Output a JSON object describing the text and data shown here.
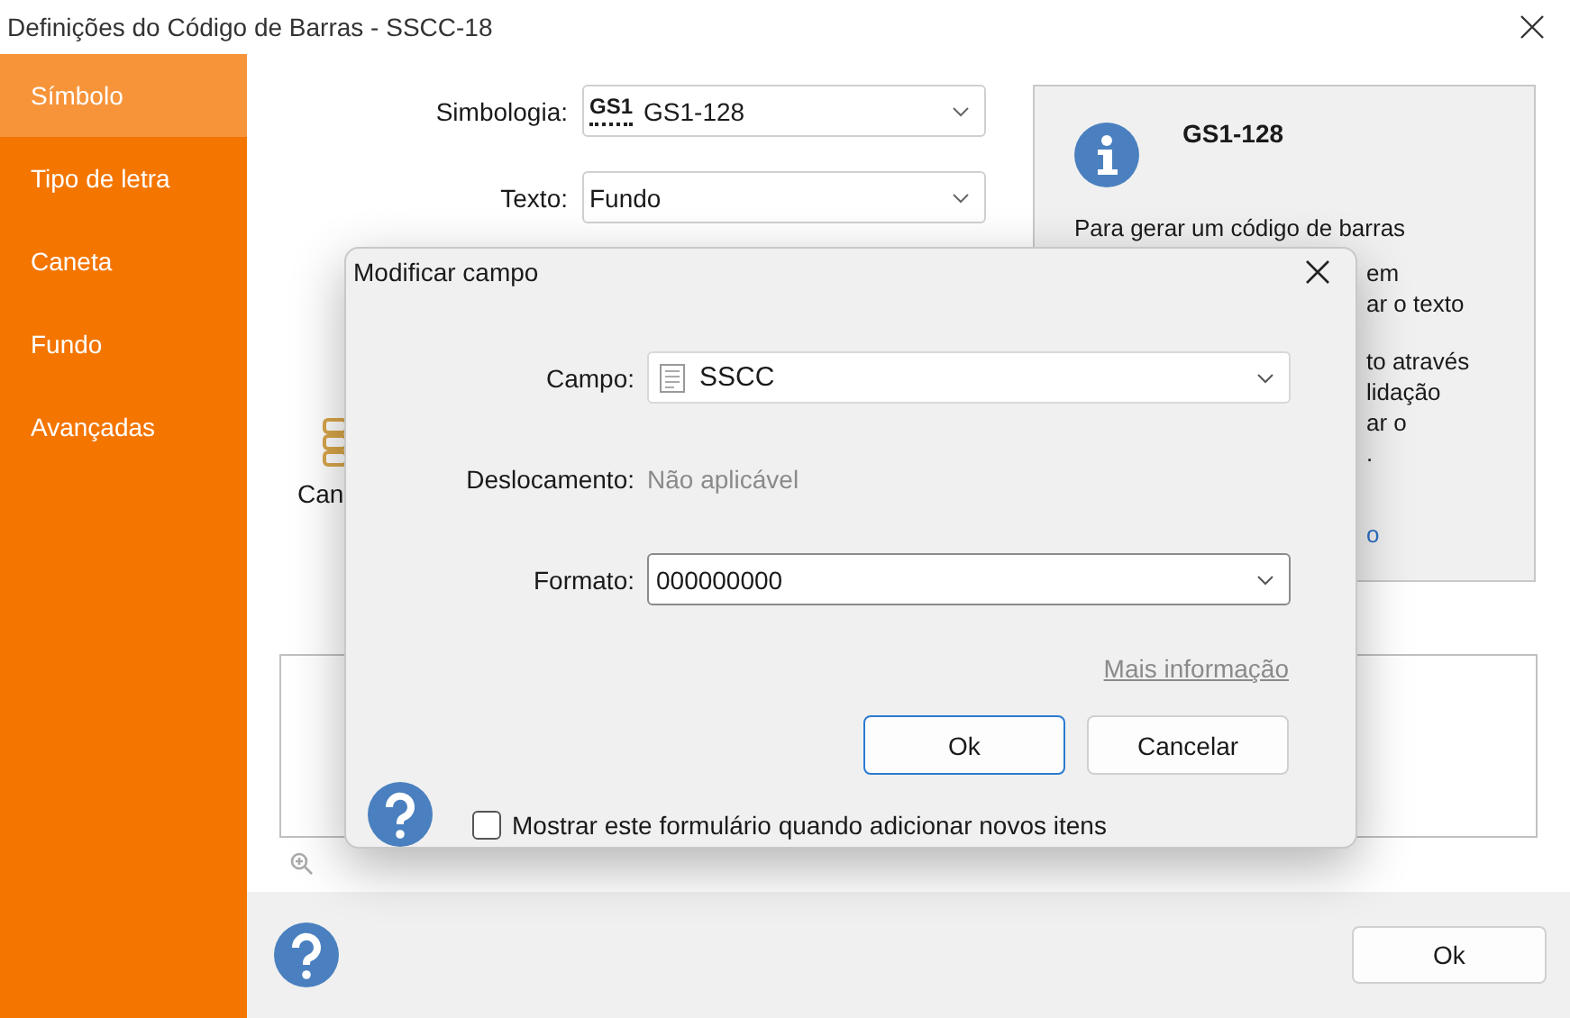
{
  "window": {
    "title": "Definições do Código de Barras - SSCC-18"
  },
  "sidebar": {
    "items": [
      {
        "label": "Símbolo",
        "selected": true
      },
      {
        "label": "Tipo de letra",
        "selected": false
      },
      {
        "label": "Caneta",
        "selected": false
      },
      {
        "label": "Fundo",
        "selected": false
      },
      {
        "label": "Avançadas",
        "selected": false
      }
    ]
  },
  "main": {
    "fields": [
      {
        "label": "Simbologia:",
        "value": "GS1-128",
        "kind": "symbology",
        "logo": "GS1"
      },
      {
        "label": "Texto:",
        "value": "Fundo",
        "kind": "plain"
      }
    ],
    "info_panel": {
      "title": "GS1-128",
      "first_line": "Para gerar um  código de barras",
      "fragments_1": [
        "em",
        "ar o texto"
      ],
      "fragments_2": [
        "to através",
        "lidação",
        "ar o",
        "."
      ],
      "link_fragment": "o"
    },
    "tool_label": "Can",
    "ok_button": "Ok"
  },
  "dialog": {
    "title": "Modificar campo",
    "fields": [
      {
        "label": "Campo:",
        "kind": "select",
        "value": "SSCC"
      },
      {
        "label": "Deslocamento:",
        "kind": "static",
        "value": "Não aplicável"
      },
      {
        "label": "Formato:",
        "kind": "combo",
        "value": "000000000"
      }
    ],
    "link": "Mais informação",
    "buttons": [
      {
        "label": "Ok",
        "default": true
      },
      {
        "label": "Cancelar",
        "default": false
      }
    ],
    "checkbox": {
      "label": "Mostrar este formulário quando adicionar novos itens",
      "checked": false
    }
  }
}
